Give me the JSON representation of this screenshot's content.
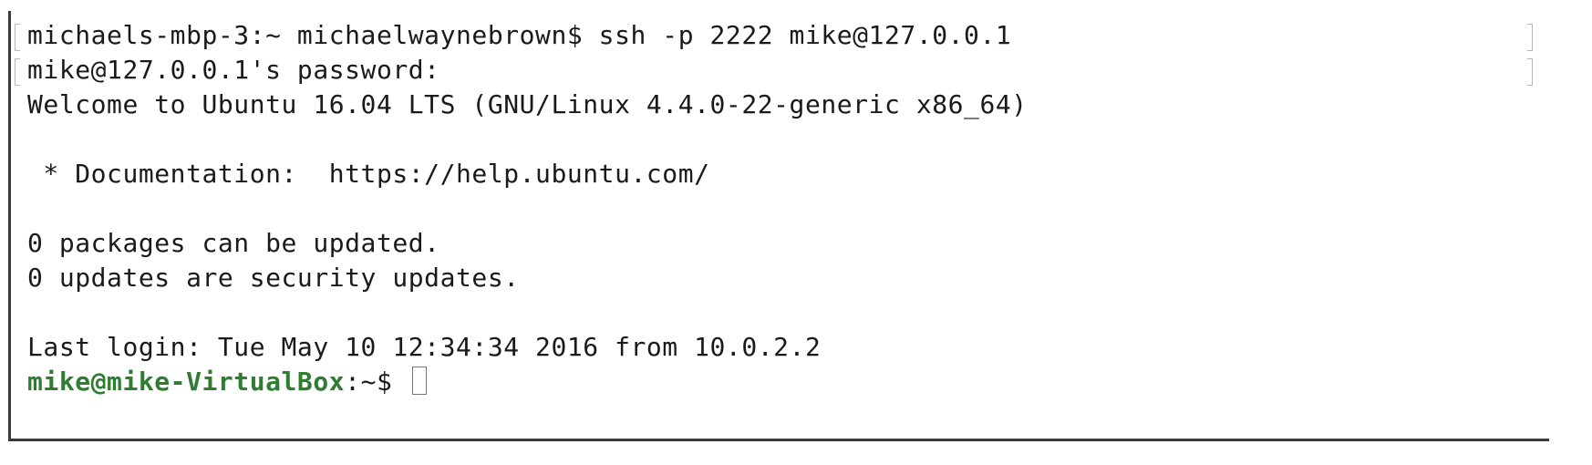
{
  "terminal": {
    "lines": [
      "michaels-mbp-3:~ michaelwaynebrown$ ssh -p 2222 mike@127.0.0.1",
      "mike@127.0.0.1's password:",
      "Welcome to Ubuntu 16.04 LTS (GNU/Linux 4.4.0-22-generic x86_64)",
      " * Documentation:  https://help.ubuntu.com/",
      "0 packages can be updated.",
      "0 updates are security updates.",
      "Last login: Tue May 10 12:34:34 2016 from 10.0.2.2"
    ],
    "prompt": {
      "user_host": "mike@mike-VirtualBox",
      "path_suffix": ":~$ "
    }
  },
  "colors": {
    "prompt_user": "#2f7d32",
    "text": "#1a1a1a",
    "background": "#ffffff"
  }
}
